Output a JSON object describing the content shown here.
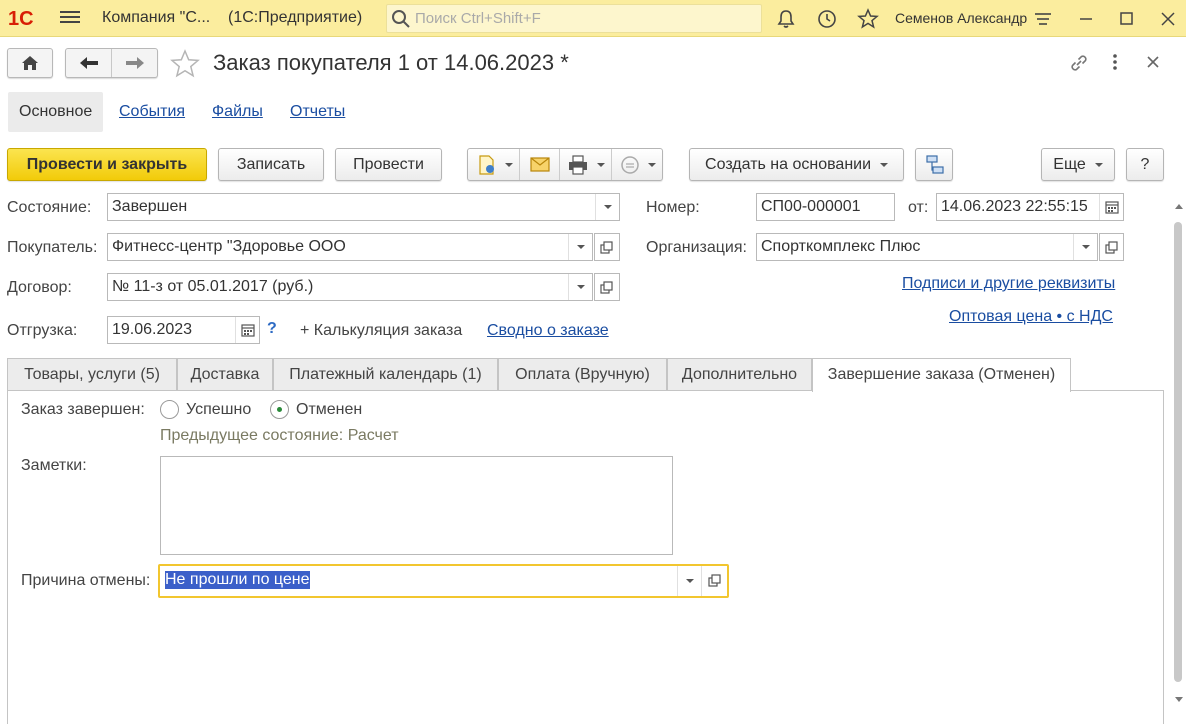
{
  "appbar": {
    "logo_text": "1С",
    "company": "Компания \"С...",
    "app_name": "(1С:Предприятие)",
    "search_placeholder": "Поиск Ctrl+Shift+F",
    "user": "Семенов Александр",
    "accent_color": "#fbed9e"
  },
  "form": {
    "title": "Заказ покупателя 1 от 14.06.2023 *"
  },
  "sections": {
    "main": "Основное",
    "events": "События",
    "files": "Файлы",
    "reports": "Отчеты"
  },
  "toolbar": {
    "post_close": "Провести и закрыть",
    "save": "Записать",
    "post": "Провести",
    "create_based": "Создать на основании",
    "more": "Еще",
    "help": "?"
  },
  "fields": {
    "state_label": "Состояние:",
    "state_value": "Завершен",
    "buyer_label": "Покупатель:",
    "buyer_value": "Фитнесс-центр \"Здоровье ООО",
    "contract_label": "Договор:",
    "contract_value": "№ 11-з от 05.01.2017 (руб.)",
    "shipment_label": "Отгрузка:",
    "shipment_value": "19.06.2023",
    "help_mark": "?",
    "calc_link": "+ Калькуляция заказа",
    "summary_link": "Сводно о заказе",
    "number_label": "Номер:",
    "number_value": "СП00-000001",
    "from_label": "от:",
    "from_value": "14.06.2023 22:55:15",
    "org_label": "Организация:",
    "org_value": "Спорткомплекс Плюс",
    "signatures_link": "Подписи и другие реквизиты",
    "price_link": "Оптовая цена • с НДС"
  },
  "tabs": [
    {
      "label": "Товары, услуги (5)"
    },
    {
      "label": "Доставка"
    },
    {
      "label": "Платежный календарь (1)"
    },
    {
      "label": "Оплата (Вручную)"
    },
    {
      "label": "Дополнительно"
    },
    {
      "label": "Завершение заказа (Отменен)"
    }
  ],
  "completion": {
    "completed_label": "Заказ завершен:",
    "option_success": "Успешно",
    "option_cancelled": "Отменен",
    "selected": "Отменен",
    "previous_state": "Предыдущее состояние: Расчет",
    "notes_label": "Заметки:",
    "notes_value": "",
    "cancel_reason_label": "Причина отмены:",
    "cancel_reason_value": "Не прошли по цене"
  }
}
